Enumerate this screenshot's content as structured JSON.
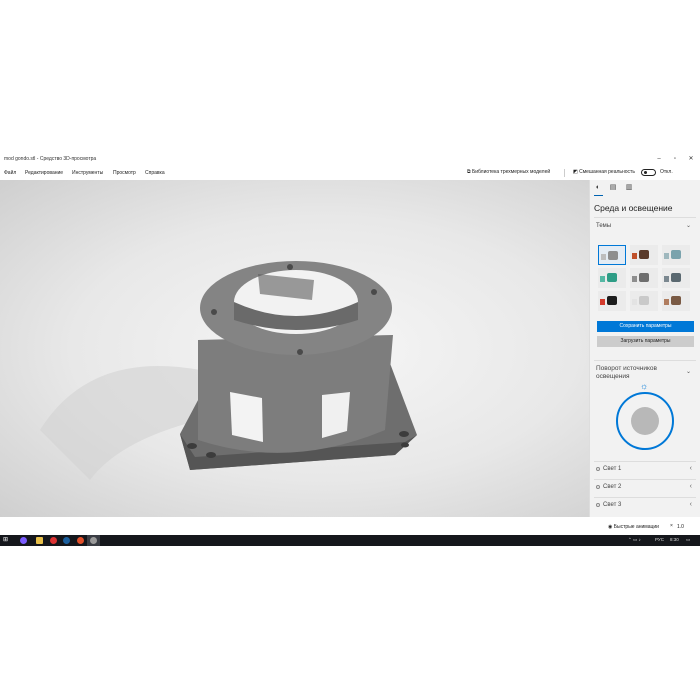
{
  "window": {
    "title": "mod gondo.stl - Средство 3D-просмотра"
  },
  "menu": {
    "items": [
      "Файл",
      "Редактирование",
      "Инструменты",
      "Просмотр",
      "Справка"
    ],
    "library_button": "Библиотека трехмерных моделей",
    "mixed_reality_label": "Смешанная реальность",
    "mixed_reality_state": "Откл."
  },
  "panel": {
    "title": "Среда и освещение",
    "themes_label": "Темы",
    "themes": [
      {
        "obj": "#8e8e8e",
        "bg": "#bdbdbd",
        "selected": true
      },
      {
        "obj": "#5a3a2a",
        "bg": "#c0502a",
        "selected": false
      },
      {
        "obj": "#7aa3ad",
        "bg": "#9fb8be",
        "selected": false
      },
      {
        "obj": "#2e9d86",
        "bg": "#56b8a4",
        "selected": false
      },
      {
        "obj": "#6e6e6e",
        "bg": "#8d8d8d",
        "selected": false
      },
      {
        "obj": "#5a6870",
        "bg": "#7b8890",
        "selected": false
      },
      {
        "obj": "#1c1c1c",
        "bg": "#d33a2c",
        "selected": false
      },
      {
        "obj": "#c9c9c9",
        "bg": "#e3e3e3",
        "selected": false
      },
      {
        "obj": "#7a5a44",
        "bg": "#b07d5f",
        "selected": false
      }
    ],
    "save_button": "Сохранить параметры",
    "load_button": "Загрузить параметры",
    "rotation_label": "Поворот источников освещения",
    "lights": [
      "Свет 1",
      "Свет 2",
      "Свет 3"
    ]
  },
  "status": {
    "animation_label": "Быстрые анимации",
    "speed_label": "1.0"
  },
  "taskbar": {
    "tray_lang": "РУС",
    "tray_time": "8:30"
  },
  "colors": {
    "accent": "#0078d7",
    "model": "#7a7a7a",
    "taskbar": "#15171c"
  },
  "icons": {
    "environment_tab": "sun-tab-icon",
    "stats_tab": "stats-tab-icon",
    "grid_tab": "wireframe-tab-icon"
  }
}
